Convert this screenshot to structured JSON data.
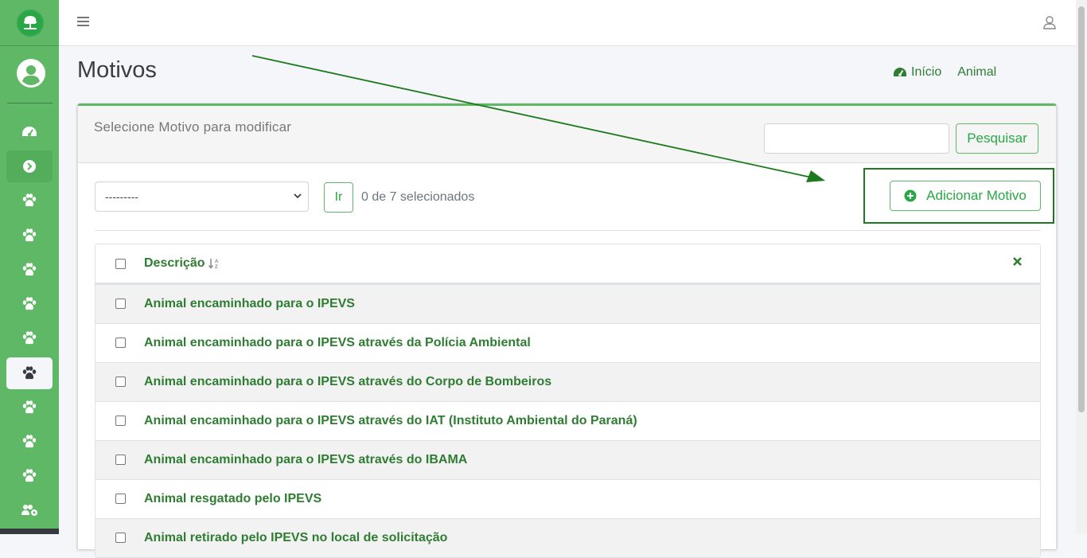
{
  "page": {
    "title": "Motivos"
  },
  "breadcrumb": {
    "home": "Início",
    "current": "Animal"
  },
  "card": {
    "header_title": "Selecione Motivo para modificar",
    "search_placeholder": "",
    "search_button": "Pesquisar",
    "action_select_value": "---------",
    "go_button": "Ir",
    "selection_counter": "0 de 7 selecionados",
    "add_button": "Adicionar Motivo"
  },
  "table": {
    "header": "Descrição",
    "rows": [
      "Animal encaminhado para o IPEVS",
      "Animal encaminhado para o IPEVS através da Polícia Ambiental",
      "Animal encaminhado para o IPEVS através do Corpo de Bombeiros",
      "Animal encaminhado para o IPEVS através do IAT (Instituto Ambiental do Paraná)",
      "Animal encaminhado para o IPEVS através do IBAMA",
      "Animal resgatado pelo IPEVS",
      "Animal retirado pelo IPEVS no local de solicitação"
    ]
  },
  "sidebar": {
    "items": [
      "dashboard-icon",
      "chevron-circle-right-icon",
      "paw-icon",
      "paw-icon",
      "paw-icon",
      "paw-icon",
      "paw-icon",
      "paw-icon",
      "paw-icon",
      "paw-icon",
      "paw-icon",
      "users-cog-icon"
    ]
  },
  "colors": {
    "brand_green": "#5fb865",
    "link_green": "#2f7d32",
    "accent_green": "#28a745"
  }
}
